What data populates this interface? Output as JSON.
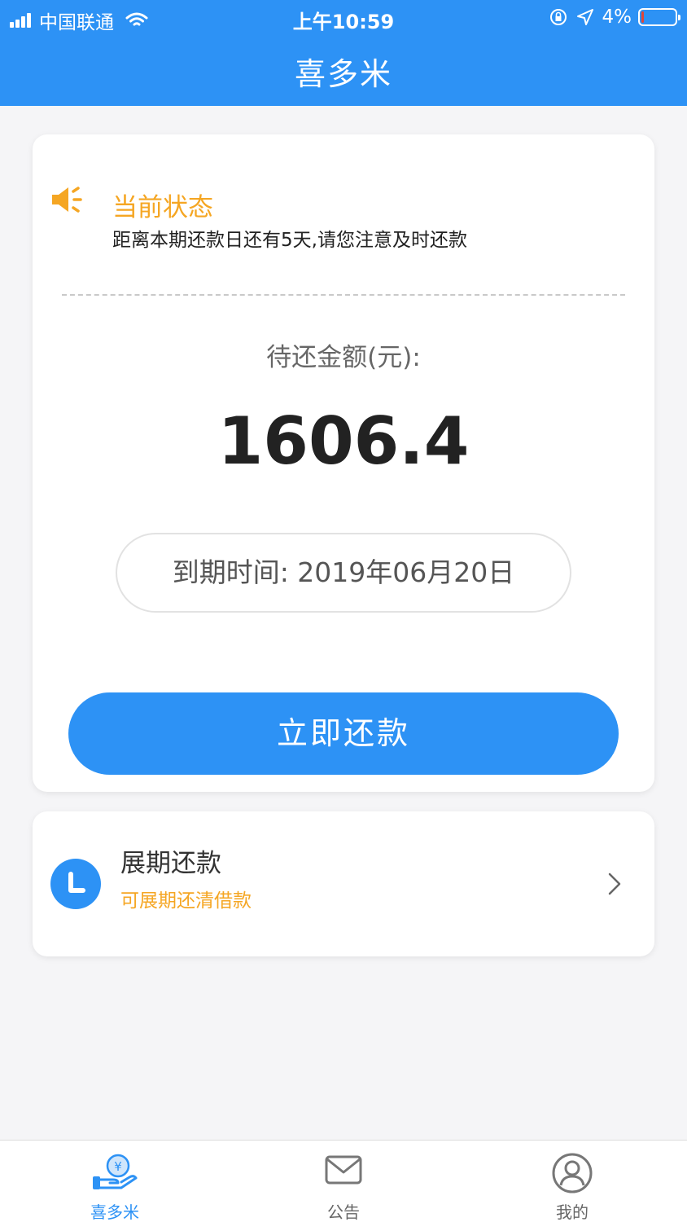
{
  "status_bar": {
    "carrier": "中国联通",
    "time": "上午10:59",
    "battery_percent_text": "4%",
    "battery_level": 0.04
  },
  "header": {
    "title": "喜多米"
  },
  "main_card": {
    "status_title": "当前状态",
    "status_message": "距离本期还款日还有5天,请您注意及时还款",
    "amount_label": "待还金额(元):",
    "amount_value": "1606.4",
    "due_date_text": "到期时间: 2019年06月20日",
    "pay_button_label": "立即还款"
  },
  "extension_card": {
    "title": "展期还款",
    "subtitle": "可展期还清借款"
  },
  "tabbar": {
    "tabs": [
      {
        "label": "喜多米",
        "icon": "yen-hand-icon",
        "active": true
      },
      {
        "label": "公告",
        "icon": "envelope-icon",
        "active": false
      },
      {
        "label": "我的",
        "icon": "user-icon",
        "active": false
      }
    ]
  },
  "colors": {
    "primary": "#2d92f5",
    "accent": "#f5a623",
    "battery_low": "#e0463a"
  }
}
